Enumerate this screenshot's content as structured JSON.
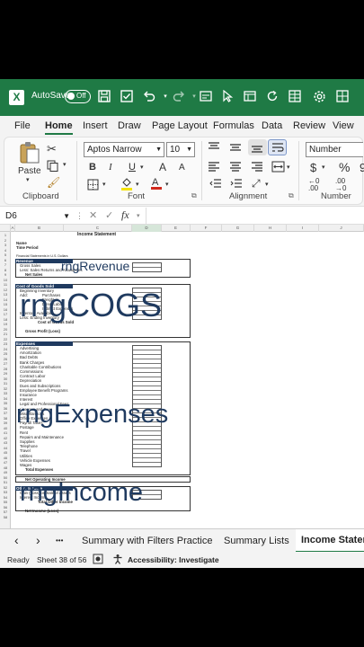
{
  "titlebar": {
    "logo": "X",
    "autosave_label": "AutoSave",
    "autosave_state": "Off",
    "icons": [
      "save-icon",
      "checkmark-icon",
      "undo-icon",
      "redo-icon",
      "form-icon",
      "pointer-icon",
      "window-icon",
      "refresh-icon",
      "settings-icon",
      "grid-icon"
    ]
  },
  "tabs": [
    "File",
    "Home",
    "Insert",
    "Draw",
    "Page Layout",
    "Formulas",
    "Data",
    "Review",
    "View"
  ],
  "active_tab": "Home",
  "ribbon": {
    "clipboard": {
      "paste": "Paste",
      "label": "Clipboard"
    },
    "font": {
      "name": "Aptos Narrow",
      "size": "10",
      "bold": "B",
      "italic": "I",
      "underline": "U",
      "grow": "A",
      "shrink": "A",
      "label": "Font"
    },
    "alignment": {
      "label": "Alignment"
    },
    "number": {
      "format": "Number",
      "currency": "$",
      "percent": "%",
      "comma": "9",
      "label": "Number"
    }
  },
  "formula_bar": {
    "name_box": "D6",
    "fx": "fx"
  },
  "sheet": {
    "columns": [
      "A",
      "B",
      "C",
      "D",
      "E",
      "F",
      "G",
      "H",
      "I",
      "J"
    ],
    "rows": [
      "1",
      "2",
      "3",
      "4",
      "5",
      "6",
      "7",
      "8",
      "9",
      "10",
      "11",
      "12",
      "13",
      "14",
      "15",
      "16",
      "17",
      "18",
      "19",
      "20",
      "21",
      "22",
      "23",
      "24",
      "25",
      "26",
      "27",
      "28",
      "29",
      "30",
      "31",
      "32",
      "33",
      "34",
      "35",
      "36",
      "37",
      "38",
      "39",
      "40",
      "41",
      "42",
      "43",
      "44",
      "45",
      "46",
      "47",
      "48",
      "49",
      "50",
      "51",
      "52",
      "53",
      "54",
      "55",
      "56",
      "57",
      "58"
    ],
    "title": "Income Statement",
    "name_label": "Name",
    "time_label": "Time Period",
    "note": "Financial Statements in U.S. Dollars",
    "revenue": {
      "header": "Revenue",
      "items": [
        "Gross Sales",
        "Less: Sales Returns and Allowances"
      ],
      "total": "Net Sales",
      "range_name": "rngRevenue"
    },
    "cogs": {
      "header": "Cost of Goods Sold",
      "items": [
        "Beginning Inventory",
        "Add:",
        "Purchases",
        "Freight-in",
        "Direct Labor",
        "Indirect Expenses",
        "Inventory Available",
        "Less: Ending Inventory"
      ],
      "total": "Cost of Goods Sold",
      "gross_profit": "Gross Profit (Loss)",
      "range_name": "rngCOGS"
    },
    "expenses": {
      "header": "Expenses",
      "items": [
        "Advertising",
        "Amortization",
        "Bad Debts",
        "Bank Charges",
        "Charitable Contributions",
        "Commissions",
        "Contract Labor",
        "Depreciation",
        "Dues and Subscriptions",
        "Employee Benefit Programs",
        "Insurance",
        "Interest",
        "Legal and Professional Fees",
        "Licenses and Fees",
        "Miscellaneous",
        "Office Expenses",
        "Payroll Taxes",
        "Postage",
        "Rent",
        "Repairs and Maintenance",
        "Supplies",
        "Telephone",
        "Travel",
        "Utilities",
        "Vehicle Expenses",
        "Wages"
      ],
      "total": "Total Expenses",
      "range_name": "rngExpenses"
    },
    "income": {
      "operating": "Net Operating Income",
      "header": "Other Income",
      "items": [
        "Gain (Loss) on Sale of Assets",
        "Interest Income"
      ],
      "total": "Total Other Income",
      "net": "Net Income (Loss)",
      "range_name": "rngIncome"
    }
  },
  "sheet_tabs": {
    "prev": "‹",
    "next": "›",
    "more": "•••",
    "items": [
      "Summary with Filters Practice",
      "Summary Lists",
      "Income Statement"
    ],
    "active": "Income Statement"
  },
  "status": {
    "ready": "Ready",
    "sheet_count": "Sheet 38 of 56",
    "accessibility": "Accessibility: Investigate"
  },
  "colors": {
    "accent": "#1f7a45",
    "section_header": "#1f3a5f"
  }
}
